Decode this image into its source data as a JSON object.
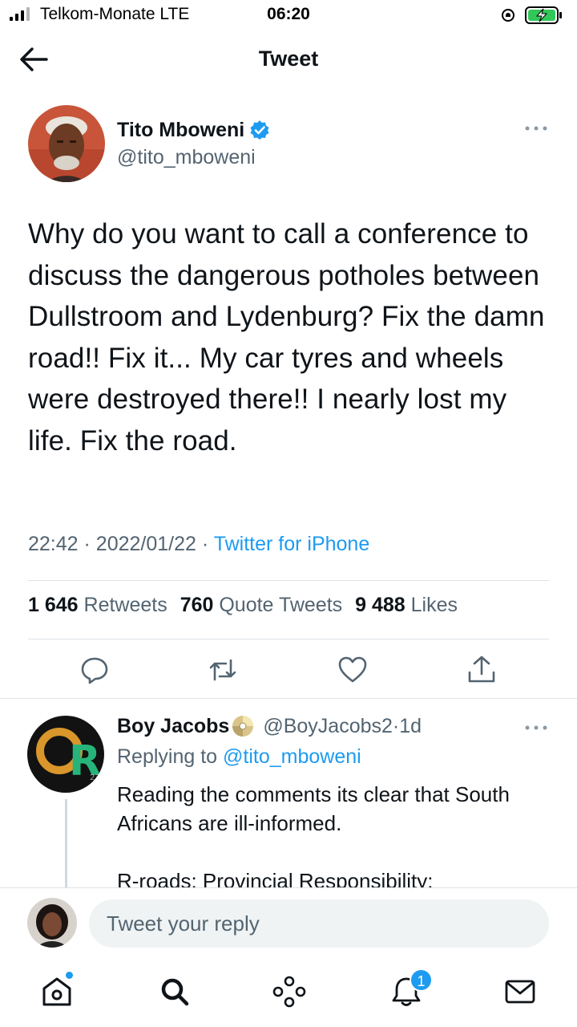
{
  "status_bar": {
    "carrier": "Telkom-Monate  LTE",
    "time": "06:20"
  },
  "header": {
    "title": "Tweet"
  },
  "tweet": {
    "author_name": "Tito Mboweni",
    "author_handle": "@tito_mboweni",
    "verified": true,
    "text": "Why do you want to call a conference to discuss the dangerous potholes between Dullstroom and Lydenburg? Fix the damn road!! Fix it... My car tyres and wheels were destroyed there!! I nearly lost my life. Fix the road.",
    "time": "22:42",
    "date": "2022/01/22",
    "separator": "·",
    "source": "Twitter for iPhone",
    "stats": {
      "retweets_count": "1 646",
      "retweets_label": "Retweets",
      "quotes_count": "760",
      "quotes_label": "Quote Tweets",
      "likes_count": "9 488",
      "likes_label": "Likes"
    },
    "actions": [
      "reply-icon",
      "retweet-icon",
      "like-icon",
      "share-icon"
    ]
  },
  "reply": {
    "name": "Boy Jacobs",
    "handle": "@BoyJacobs2",
    "dot": "·",
    "time": "1d",
    "replying_prefix": "Replying to ",
    "replying_to": "@tito_mboweni",
    "text": "Reading the comments its clear that South Africans are ill-informed.",
    "text_continued": "R-roads: Provincial Responsibility:"
  },
  "compose": {
    "placeholder": "Tweet your reply"
  },
  "tab_bar": {
    "items": [
      "home-icon",
      "search-icon",
      "spaces-icon",
      "notifications-icon",
      "messages-icon"
    ],
    "notifications_badge": "1"
  },
  "colors": {
    "accent": "#1d9bf0",
    "text_primary": "#0f1419",
    "text_secondary": "#536471",
    "divider": "#dde3e7"
  }
}
